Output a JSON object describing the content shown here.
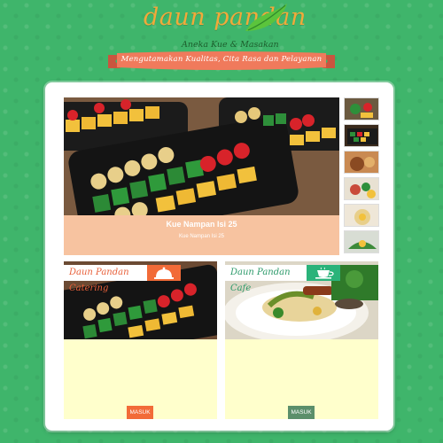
{
  "brand": {
    "title": "daun pandan",
    "tagline": "Aneka Kue & Masakan",
    "ribbon": "Mengutamakan Kualitas, Cita Rasa dan Pelayanan"
  },
  "slider": {
    "caption_title": "Kue Nampan Isi 25",
    "caption_sub": "Kue Nampan Isi 25"
  },
  "cards": [
    {
      "label": "Daun Pandan Catering",
      "icon": "cloche-icon",
      "button": "MASUK",
      "accent": "#f26b38"
    },
    {
      "label": "Daun Pandan Cafe",
      "icon": "cup-icon",
      "button": "MASUK",
      "accent": "#2ab37a"
    }
  ],
  "colors": {
    "background": "#3fb56b",
    "caption": "#f7c3a0",
    "card_body": "#ffffcc",
    "catering_button": "#f26b38",
    "cafe_button": "#5b8f6b",
    "logo": "#f1a93a",
    "ribbon": "#f07a5c"
  }
}
